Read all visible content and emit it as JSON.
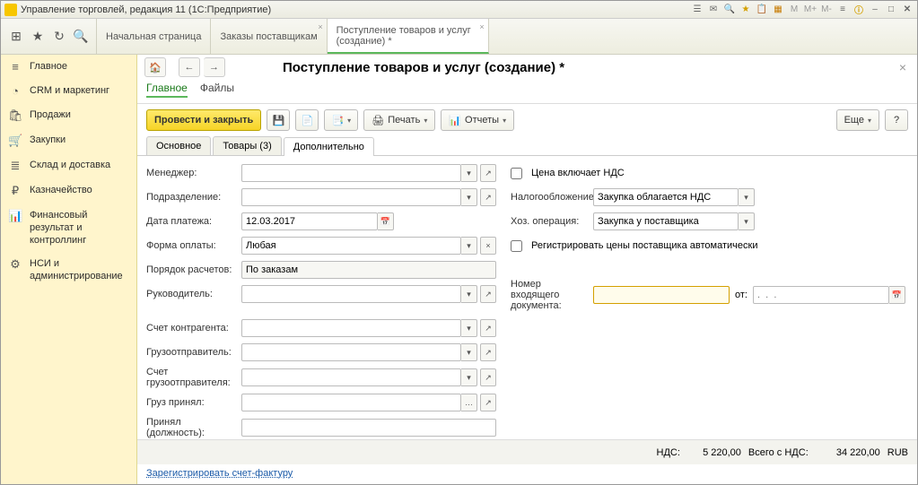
{
  "window": {
    "title": "Управление торговлей, редакция 11  (1С:Предприятие)"
  },
  "topTabs": [
    {
      "label": "Начальная страница",
      "closable": false
    },
    {
      "label": "Заказы поставщикам",
      "closable": true
    },
    {
      "label": "Поступление товаров и услуг (создание) *",
      "closable": true,
      "active": true
    }
  ],
  "sidebar": [
    {
      "icon": "≡",
      "label": "Главное"
    },
    {
      "icon": "◔",
      "label": "CRM и маркетинг"
    },
    {
      "icon": "🛍",
      "label": "Продажи"
    },
    {
      "icon": "🛒",
      "label": "Закупки"
    },
    {
      "icon": "≣",
      "label": "Склад и доставка"
    },
    {
      "icon": "₽",
      "label": "Казначейство"
    },
    {
      "icon": "📊",
      "label": "Финансовый результат и контроллинг"
    },
    {
      "icon": "⚙",
      "label": "НСИ и администрирование"
    }
  ],
  "page": {
    "title": "Поступление товаров и услуг (создание) *",
    "subTabs": [
      {
        "label": "Главное",
        "active": true
      },
      {
        "label": "Файлы"
      }
    ],
    "toolbar": {
      "primary": "Провести и закрыть",
      "print": "Печать",
      "reports": "Отчеты",
      "more": "Еще"
    },
    "innerTabs": [
      {
        "label": "Основное"
      },
      {
        "label": "Товары (3)"
      },
      {
        "label": "Дополнительно",
        "active": true
      }
    ]
  },
  "form": {
    "left": {
      "manager_lbl": "Менеджер:",
      "dept_lbl": "Подразделение:",
      "paydate_lbl": "Дата платежа:",
      "paydate_val": "12.03.2017",
      "payform_lbl": "Форма оплаты:",
      "payform_val": "Любая",
      "payorder_lbl": "Порядок расчетов:",
      "payorder_val": "По заказам",
      "head_lbl": "Руководитель:",
      "acct_lbl": "Счет контрагента:",
      "shipper_lbl": "Грузоотправитель:",
      "shipacct_lbl": "Счет грузоотправителя:",
      "recv_lbl": "Груз принял:",
      "post_lbl": "Принял (должность):"
    },
    "right": {
      "vat_incl_lbl": "Цена включает НДС",
      "tax_lbl": "Налогообложение:",
      "tax_val": "Закупка облагается НДС",
      "oper_lbl": "Хоз. операция:",
      "oper_val": "Закупка у поставщика",
      "reg_prices_lbl": "Регистрировать цены поставщика автоматически",
      "docnum_lbl": "Номер входящего документа:",
      "ot_lbl": "от:",
      "date_placeholder": ".  .  ."
    }
  },
  "totals": {
    "vat_lbl": "НДС:",
    "vat_val": "5 220,00",
    "total_lbl": "Всего с НДС:",
    "total_val": "34 220,00",
    "currency": "RUB"
  },
  "link": {
    "invoice": "Зарегистрировать счет-фактуру"
  }
}
